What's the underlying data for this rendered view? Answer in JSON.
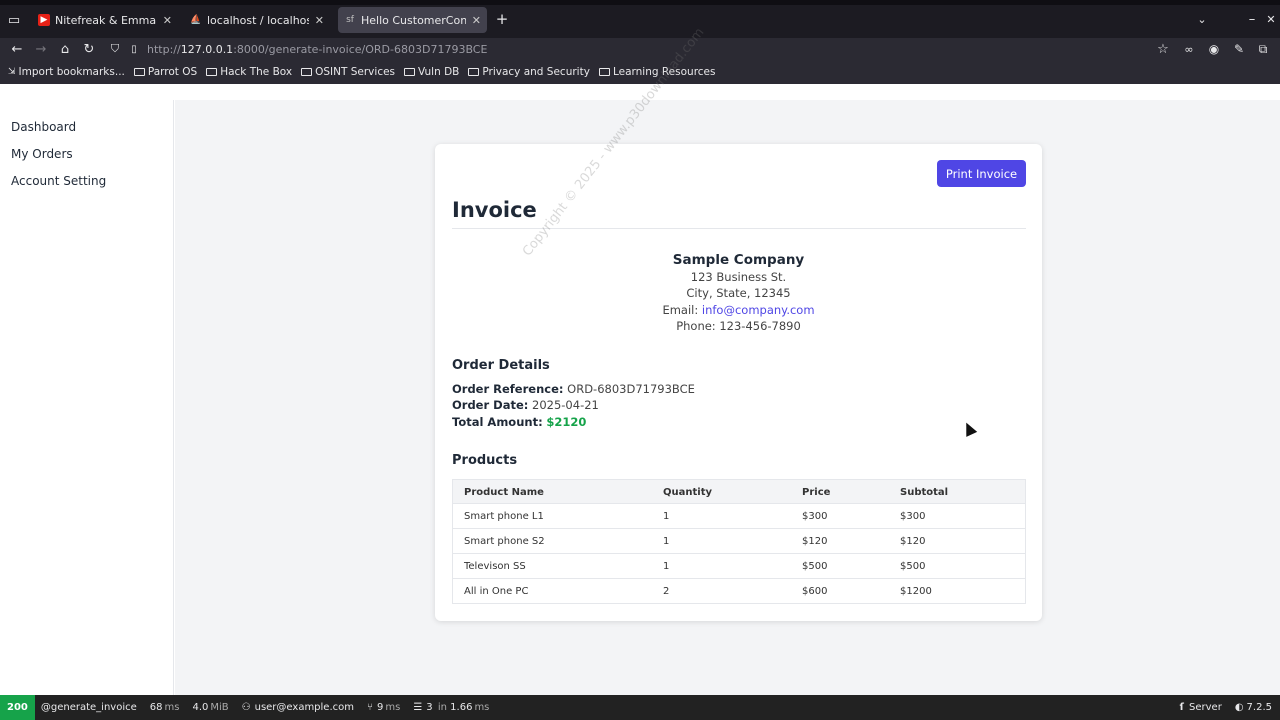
{
  "browser": {
    "tabs": [
      {
        "title": "Nitefreak & Emmanuel Ja",
        "fav_color": "#e62117",
        "active": false
      },
      {
        "title": "localhost / localhost / sho",
        "fav_color": "#f0a030",
        "active": false
      },
      {
        "title": "Hello CustomerControlle",
        "fav_color": "#c0c0c0",
        "active": true
      }
    ],
    "url_prefix": "http://",
    "url_host": "127.0.0.1",
    "url_rest": ":8000/generate-invoice/ORD-6803D71793BCE",
    "bookmarks": [
      {
        "label": "Import bookmarks...",
        "icon": "import-icon"
      },
      {
        "label": "Parrot OS",
        "icon": "folder-icon"
      },
      {
        "label": "Hack The Box",
        "icon": "folder-icon"
      },
      {
        "label": "OSINT Services",
        "icon": "folder-icon"
      },
      {
        "label": "Vuln DB",
        "icon": "folder-icon"
      },
      {
        "label": "Privacy and Security",
        "icon": "folder-icon"
      },
      {
        "label": "Learning Resources",
        "icon": "folder-icon"
      }
    ]
  },
  "sidebar": {
    "items": [
      {
        "label": "Dashboard"
      },
      {
        "label": "My Orders"
      },
      {
        "label": "Account Setting"
      }
    ]
  },
  "invoice": {
    "print_label": "Print Invoice",
    "title": "Invoice",
    "company": {
      "name": "Sample Company",
      "street": "123 Business St.",
      "city": "City, State, 12345",
      "email_label": "Email:",
      "email": "info@company.com",
      "phone": "Phone: 123-456-7890"
    },
    "order_details_title": "Order Details",
    "order_ref_label": "Order Reference:",
    "order_ref": "ORD-6803D71793BCE",
    "order_date_label": "Order Date:",
    "order_date": "2025-04-21",
    "total_label": "Total Amount:",
    "total": "$2120",
    "products_title": "Products",
    "table_headers": [
      "Product Name",
      "Quantity",
      "Price",
      "Subtotal"
    ],
    "products": [
      {
        "name": "Smart phone L1",
        "qty": "1",
        "price": "$300",
        "subtotal": "$300"
      },
      {
        "name": "Smart phone S2",
        "qty": "1",
        "price": "$120",
        "subtotal": "$120"
      },
      {
        "name": "Televison SS",
        "qty": "1",
        "price": "$500",
        "subtotal": "$500"
      },
      {
        "name": "All in One PC",
        "qty": "2",
        "price": "$600",
        "subtotal": "$1200"
      }
    ]
  },
  "watermark": "Copyright © 2025 - www.p30download.com",
  "debug": {
    "status": "200",
    "route": "@generate_invoice",
    "time": "68",
    "time_unit": "ms",
    "memory": "4.0",
    "memory_unit": "MiB",
    "user": "user@example.com",
    "twig": "9",
    "twig_unit": "ms",
    "db_queries": "3",
    "db_in": "in",
    "db_time": "1.66",
    "db_unit": "ms",
    "server_label": "Server",
    "symfony_version": "7.2.5"
  },
  "colors": {
    "accent": "#4f46e5",
    "success": "#16a34a",
    "status_ok": "#16a34a"
  }
}
